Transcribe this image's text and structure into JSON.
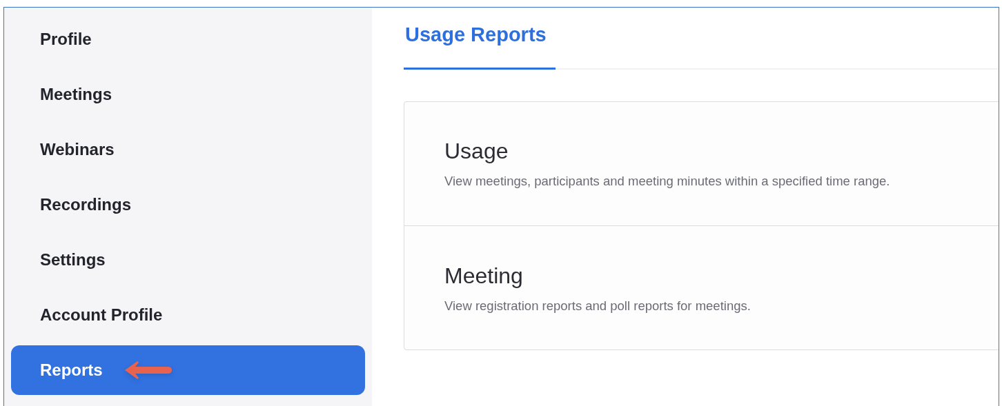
{
  "sidebar": {
    "items": [
      {
        "label": "Profile",
        "selected": false
      },
      {
        "label": "Meetings",
        "selected": false
      },
      {
        "label": "Webinars",
        "selected": false
      },
      {
        "label": "Recordings",
        "selected": false
      },
      {
        "label": "Settings",
        "selected": false
      },
      {
        "label": "Account Profile",
        "selected": false
      },
      {
        "label": "Reports",
        "selected": true
      }
    ]
  },
  "tabs": [
    {
      "label": "Usage Reports",
      "selected": true
    }
  ],
  "reports": [
    {
      "title": "Usage",
      "description": "View meetings, participants and meeting minutes within a specified time range."
    },
    {
      "title": "Meeting",
      "description": "View registration reports and poll reports for meetings."
    }
  ]
}
